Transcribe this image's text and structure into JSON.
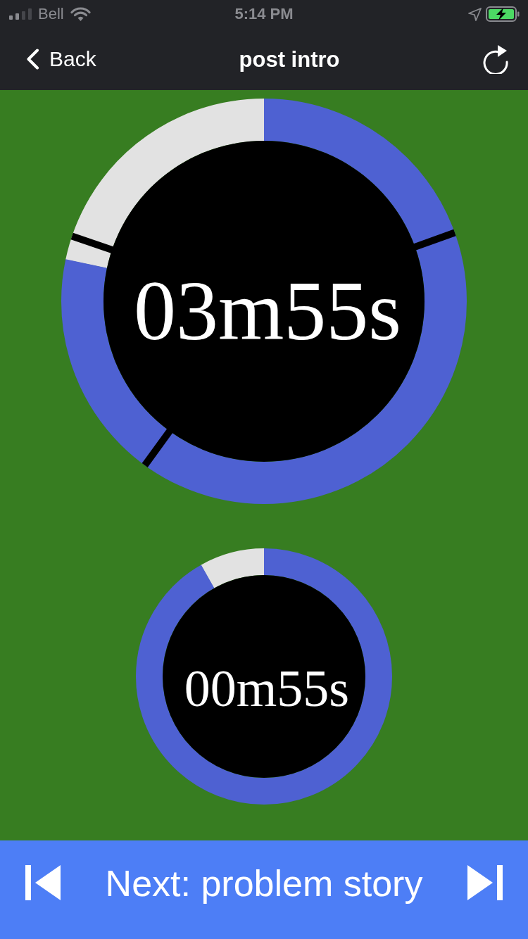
{
  "status_bar": {
    "carrier": "Bell",
    "time": "5:14 PM"
  },
  "nav_bar": {
    "back": "Back",
    "title": "post intro"
  },
  "timers": [
    {
      "kind": "large",
      "time": "03m55s",
      "level": 0.783,
      "sectioned": true
    },
    {
      "kind": "small",
      "time": "00m55s",
      "level": 0.918,
      "sectioned": false
    }
  ],
  "footer": {
    "next": "Next: problem story"
  }
}
